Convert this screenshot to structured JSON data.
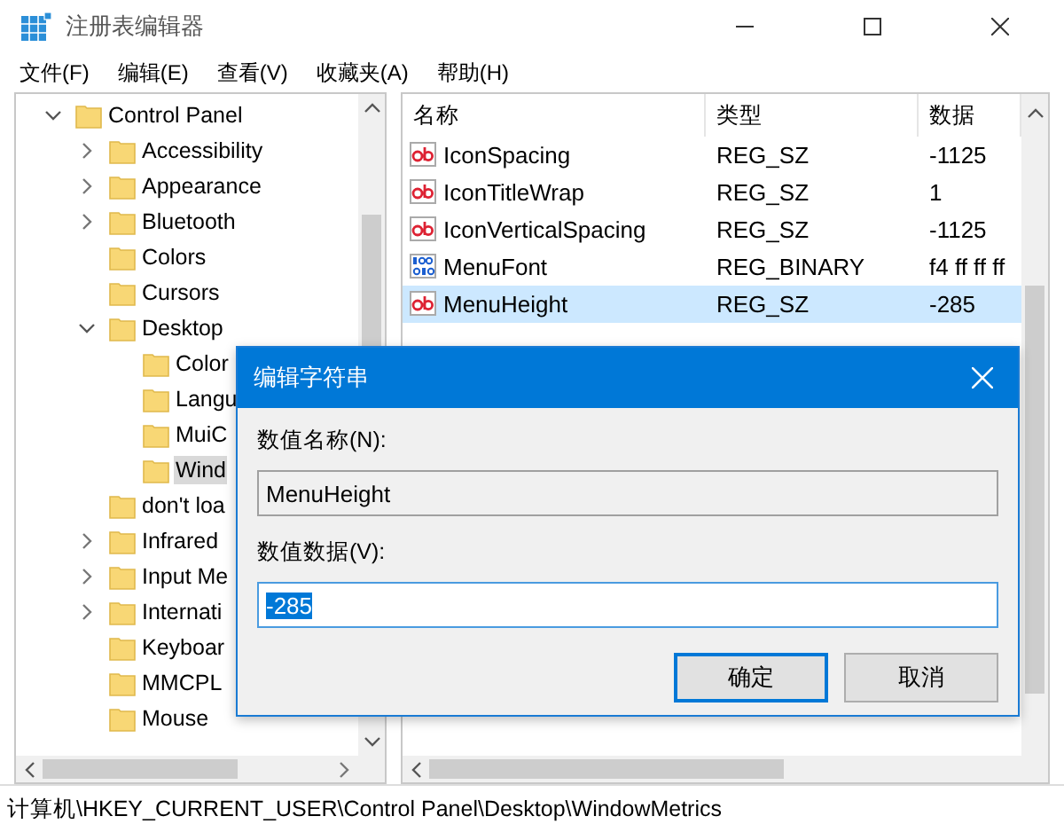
{
  "window": {
    "title": "注册表编辑器"
  },
  "menu": [
    "文件(F)",
    "编辑(E)",
    "查看(V)",
    "收藏夹(A)",
    "帮助(H)"
  ],
  "tree": [
    {
      "label": "Control Panel",
      "expanded": true,
      "selected": false,
      "children": [
        {
          "label": "Accessibility",
          "expanded": false,
          "selected": false
        },
        {
          "label": "Appearance",
          "expanded": false,
          "selected": false
        },
        {
          "label": "Bluetooth",
          "expanded": false,
          "selected": false
        },
        {
          "label": "Colors",
          "selected": false
        },
        {
          "label": "Cursors",
          "selected": false
        },
        {
          "label": "Desktop",
          "expanded": true,
          "selected": false,
          "children": [
            {
              "label": "Color",
              "selected": false
            },
            {
              "label": "Langu",
              "selected": false
            },
            {
              "label": "MuiC",
              "selected": false
            },
            {
              "label": "Wind",
              "selected": true
            }
          ]
        },
        {
          "label": "don't loa",
          "selected": false
        },
        {
          "label": "Infrared",
          "expanded": false,
          "selected": false
        },
        {
          "label": "Input Me",
          "expanded": false,
          "selected": false
        },
        {
          "label": "Internati",
          "expanded": false,
          "selected": false
        },
        {
          "label": "Keyboar",
          "selected": false
        },
        {
          "label": "MMCPL",
          "selected": false
        },
        {
          "label": "Mouse",
          "selected": false
        }
      ]
    }
  ],
  "table": {
    "columns": [
      "名称",
      "类型",
      "数据"
    ],
    "rows": [
      {
        "kind": "string",
        "name": "IconSpacing",
        "type": "REG_SZ",
        "data": "-1125",
        "selected": false
      },
      {
        "kind": "string",
        "name": "IconTitleWrap",
        "type": "REG_SZ",
        "data": "1",
        "selected": false
      },
      {
        "kind": "string",
        "name": "IconVerticalSpacing",
        "type": "REG_SZ",
        "data": "-1125",
        "selected": false
      },
      {
        "kind": "binary",
        "name": "MenuFont",
        "type": "REG_BINARY",
        "data": "f4 ff ff ff",
        "selected": false
      },
      {
        "kind": "string",
        "name": "MenuHeight",
        "type": "REG_SZ",
        "data": "-285",
        "selected": true
      }
    ]
  },
  "dialog": {
    "title": "编辑字符串",
    "name_label": "数值名称(N):",
    "name_value": "MenuHeight",
    "data_label": "数值数据(V):",
    "data_value": "-285",
    "data_selected": true,
    "buttons": [
      {
        "label": "确定",
        "default": true
      },
      {
        "label": "取消",
        "default": false
      }
    ]
  },
  "status_bar": "计算机\\HKEY_CURRENT_USER\\Control Panel\\Desktop\\WindowMetrics"
}
